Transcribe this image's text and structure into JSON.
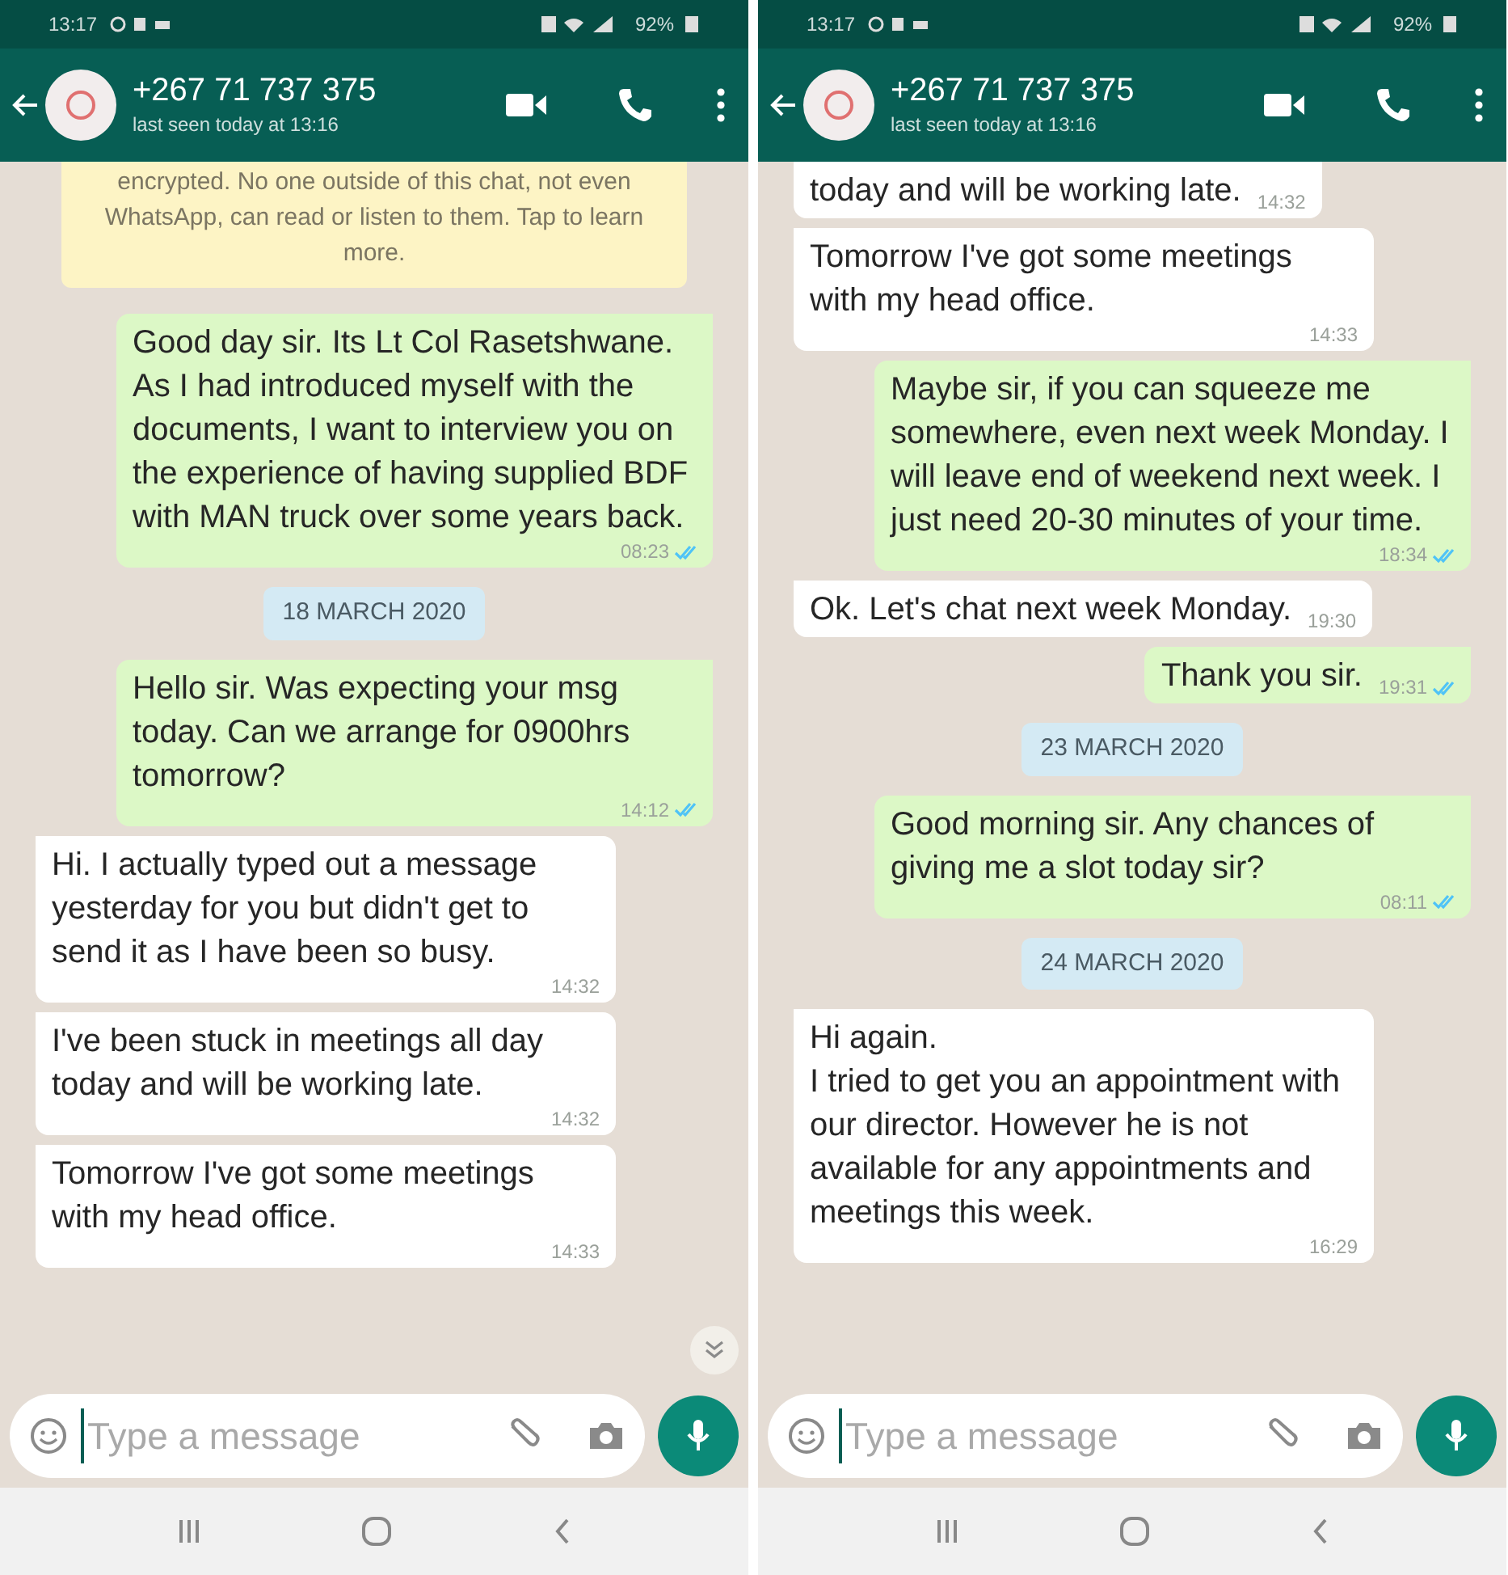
{
  "phones": [
    {
      "status_bar": {
        "time": "13:17",
        "battery": "92%"
      },
      "header": {
        "name": "+267 71 737 375",
        "last_seen": "last seen today at 13:16"
      },
      "messages": [
        {
          "kind": "notice",
          "text": "encrypted. No one outside of this chat, not even WhatsApp, can read or listen to them. Tap to learn more."
        },
        {
          "kind": "out",
          "text": "Good day sir. Its Lt Col Rasetshwane. As  I had introduced myself with the documents, I want to interview you on the experience of having supplied BDF with MAN truck over some years back.",
          "time": "08:23"
        },
        {
          "kind": "date",
          "text": "18 MARCH 2020"
        },
        {
          "kind": "out",
          "text": "Hello sir. Was expecting your msg today. Can we arrange for 0900hrs tomorrow?",
          "time": "14:12"
        },
        {
          "kind": "in",
          "text": "Hi. I actually typed out a message yesterday for you but didn't get to send it as I have been so busy.",
          "time": "14:32"
        },
        {
          "kind": "in",
          "text": "I've been stuck in meetings all day today and will be working late.",
          "time": "14:32"
        },
        {
          "kind": "in",
          "text": "Tomorrow I've got some meetings with my head office.",
          "time": "14:33"
        }
      ],
      "scroll_down_button": true,
      "input": {
        "placeholder": "Type a message"
      }
    },
    {
      "status_bar": {
        "time": "13:17",
        "battery": "92%"
      },
      "header": {
        "name": "+267 71 737 375",
        "last_seen": "last seen today at 13:16"
      },
      "messages": [
        {
          "kind": "in",
          "text": "today and will be working late.",
          "time": "14:32"
        },
        {
          "kind": "in",
          "text": "Tomorrow I've got some meetings with my head office.",
          "time": "14:33"
        },
        {
          "kind": "out",
          "text": "Maybe sir, if you can squeeze me somewhere,  even next week Monday. I will leave end of weekend next week. I just need 20-30 minutes of your time.",
          "time": "18:34"
        },
        {
          "kind": "in",
          "text": "Ok. Let's chat next week Monday.",
          "time": "19:30"
        },
        {
          "kind": "out",
          "text": "Thank you sir.",
          "time": "19:31"
        },
        {
          "kind": "date",
          "text": "23 MARCH 2020"
        },
        {
          "kind": "out",
          "text": "Good morning sir. Any chances of giving me a slot today sir?",
          "time": "08:11"
        },
        {
          "kind": "date",
          "text": "24 MARCH 2020"
        },
        {
          "kind": "in",
          "text": "Hi again.\nI tried to get you an appointment with our director. However he is not available for any appointments and meetings this week.",
          "time": "16:29"
        }
      ],
      "scroll_down_button": false,
      "input": {
        "placeholder": "Type a message"
      }
    }
  ]
}
